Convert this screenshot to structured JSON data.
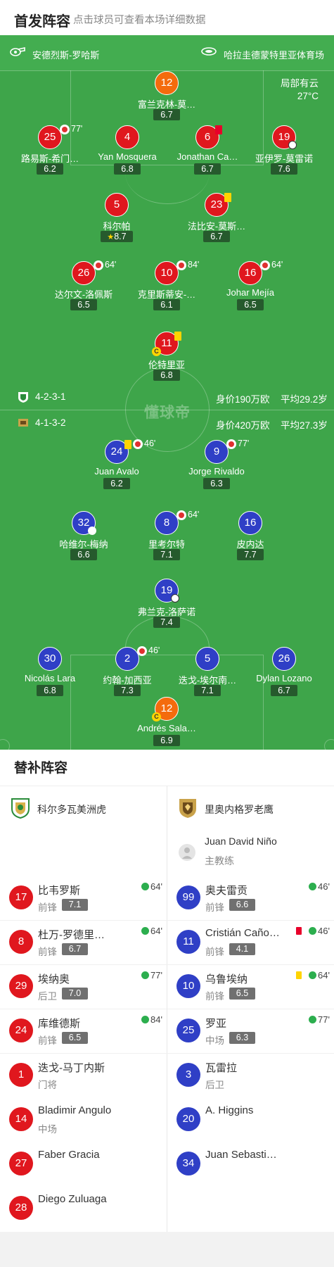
{
  "header": {
    "title": "首发阵容",
    "subtitle": "点击球员可查看本场详细数据"
  },
  "venue": {
    "referee": "安德烈斯-罗哈斯",
    "stadium": "哈拉圭德蒙特里亚体育场"
  },
  "weather": {
    "desc": "局部有云",
    "temp": "27°C"
  },
  "watermark": "懂球帝",
  "home_formation": {
    "formation": "4-2-3-1",
    "value": "身价190万欧",
    "age": "平均29.2岁"
  },
  "away_formation": {
    "formation": "4-1-3-2",
    "value": "身价420万欧",
    "age": "平均27.3岁"
  },
  "home_players": [
    {
      "num": "12",
      "name": "富兰克林-莫…",
      "rating": "6.7"
    },
    {
      "num": "25",
      "name": "路易斯-希门…",
      "rating": "6.2",
      "sub_out": "77'"
    },
    {
      "num": "4",
      "name": "Yan Mosquera",
      "rating": "6.8"
    },
    {
      "num": "6",
      "name": "Jonathan Ca…",
      "rating": "6.7"
    },
    {
      "num": "19",
      "name": "亚伊罗-莫雷诺",
      "rating": "7.6"
    },
    {
      "num": "5",
      "name": "科尔帕",
      "rating": "8.7"
    },
    {
      "num": "23",
      "name": "法比安-莫斯…",
      "rating": "6.7"
    },
    {
      "num": "26",
      "name": "达尔文-洛佩斯",
      "rating": "6.5",
      "sub_out": "64'"
    },
    {
      "num": "10",
      "name": "克里斯蒂安-…",
      "rating": "6.1",
      "sub_out": "84'"
    },
    {
      "num": "16",
      "name": "Johar Mejía",
      "rating": "6.5",
      "sub_out": "64'"
    },
    {
      "num": "11",
      "name": "伦特里亚",
      "rating": "6.8"
    }
  ],
  "away_players": [
    {
      "num": "24",
      "name": "Juan Avalo",
      "rating": "6.2",
      "sub_out": "46'"
    },
    {
      "num": "9",
      "name": "Jorge Rivaldo",
      "rating": "6.3",
      "sub_out": "77'"
    },
    {
      "num": "32",
      "name": "哈维尔-梅纳",
      "rating": "6.6"
    },
    {
      "num": "8",
      "name": "里考尔特",
      "rating": "7.1",
      "sub_out": "64'"
    },
    {
      "num": "16",
      "name": "皮内达",
      "rating": "7.7"
    },
    {
      "num": "19",
      "name": "弗兰克-洛萨诺",
      "rating": "7.4"
    },
    {
      "num": "30",
      "name": "Nicolás Lara",
      "rating": "6.8"
    },
    {
      "num": "2",
      "name": "约翰-加西亚",
      "rating": "7.3",
      "sub_out": "46'"
    },
    {
      "num": "5",
      "name": "迭戈-埃尔南…",
      "rating": "7.1"
    },
    {
      "num": "26",
      "name": "Dylan Lozano",
      "rating": "6.7"
    },
    {
      "num": "12",
      "name": "Andrés Sala…",
      "rating": "6.9"
    }
  ],
  "subs": {
    "title": "替补阵容",
    "home_team": "科尔多瓦美洲虎",
    "away_team": "里奥内格罗老鹰",
    "away_coach": {
      "name": "Juan David Niño",
      "role": "主教练"
    },
    "home": [
      {
        "num": "17",
        "name": "比韦罗斯",
        "pos": "前锋",
        "rating": "7.1",
        "in": "64'"
      },
      {
        "num": "8",
        "name": "杜万-罗德里…",
        "pos": "前锋",
        "rating": "6.7",
        "in": "64'"
      },
      {
        "num": "29",
        "name": "埃纳奥",
        "pos": "后卫",
        "rating": "7.0",
        "in": "77'"
      },
      {
        "num": "24",
        "name": "库维德斯",
        "pos": "前锋",
        "rating": "6.5",
        "in": "84'"
      },
      {
        "num": "1",
        "name": "迭戈-马丁内斯",
        "pos": "门将"
      },
      {
        "num": "14",
        "name": "Bladimir Angulo",
        "pos": "中场"
      },
      {
        "num": "27",
        "name": "Faber Gracia"
      },
      {
        "num": "28",
        "name": "Diego Zuluaga"
      }
    ],
    "away": [
      {
        "num": "99",
        "name": "奥夫雷贡",
        "pos": "前锋",
        "rating": "6.6",
        "in": "46'"
      },
      {
        "num": "11",
        "name": "Cristián Caño…",
        "pos": "前锋",
        "rating": "4.1",
        "in": "46'"
      },
      {
        "num": "10",
        "name": "乌鲁埃纳",
        "pos": "前锋",
        "rating": "6.5",
        "in": "64'"
      },
      {
        "num": "25",
        "name": "罗亚",
        "pos": "中场",
        "rating": "6.3",
        "in": "77'"
      },
      {
        "num": "3",
        "name": "瓦雷拉",
        "pos": "后卫"
      },
      {
        "num": "20",
        "name": "A. Higgins"
      },
      {
        "num": "34",
        "name": "Juan Sebasti…"
      }
    ]
  }
}
